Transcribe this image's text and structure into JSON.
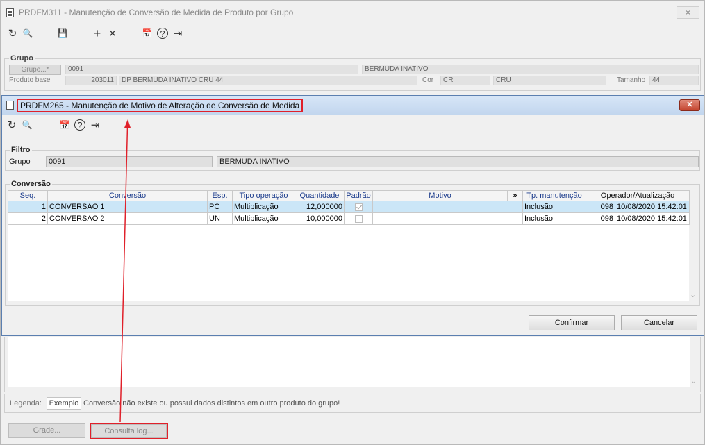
{
  "outer": {
    "title": "PRDFM311 - Manutenção de Conversão de Medida de Produto por Grupo",
    "close_icon": "×",
    "toolbar": {
      "refresh_icon": "↻",
      "search_icon": "🔍",
      "save_icon": "💾",
      "add_icon": "+",
      "delete_icon": "×",
      "calendar_icon": "📅",
      "help_icon": "?",
      "exit_icon": "⇥"
    },
    "grupo_section": {
      "legend": "Grupo",
      "grupo_button": "Grupo...*",
      "grupo_code": "0091",
      "grupo_name": "BERMUDA INATIVO",
      "produto_base_label": "Produto base",
      "produto_base_code": "203011",
      "produto_base_name": "DP BERMUDA INATIVO CRU 44",
      "cor_label": "Cor",
      "cor_code": "CR",
      "cor_name": "CRU",
      "tamanho_label": "Tamanho",
      "tamanho_value": "44"
    },
    "legenda_label": "Legenda:",
    "legenda_example": "Exemplo",
    "legenda_text": "Conversão não existe ou possui dados distintos em outro produto do grupo!",
    "grade_button": "Grade...",
    "consulta_log_button": "Consulta log..."
  },
  "inner": {
    "title": "PRDFM265 - Manutenção de Motivo de Alteração de Conversão de Medida",
    "close_icon": "✕",
    "toolbar": {
      "refresh_icon": "↻",
      "search_icon": "🔍",
      "calendar_icon": "📅",
      "help_icon": "?",
      "exit_icon": "⇥"
    },
    "filtro": {
      "legend": "Filtro",
      "grupo_label": "Grupo",
      "grupo_code": "0091",
      "grupo_name": "BERMUDA INATIVO"
    },
    "conversao": {
      "legend": "Conversão",
      "columns": [
        "Seq.",
        "Conversão",
        "Esp.",
        "Tipo operação",
        "Quantidade",
        "Padrão",
        "Motivo",
        "»",
        "Tp. manutenção",
        "Operador/Atualização"
      ],
      "rows": [
        {
          "seq": "1",
          "conversao": "CONVERSAO 1",
          "esp": "PC",
          "tipo": "Multiplicação",
          "quantidade": "12,000000",
          "padrao": true,
          "motivo_a": "",
          "motivo_b": "",
          "tp": "Inclusão",
          "operador": "098",
          "atualizacao": "10/08/2020 15:42:01"
        },
        {
          "seq": "2",
          "conversao": "CONVERSAO 2",
          "esp": "UN",
          "tipo": "Multiplicação",
          "quantidade": "10,000000",
          "padrao": false,
          "motivo_a": "",
          "motivo_b": "",
          "tp": "Inclusão",
          "operador": "098",
          "atualizacao": "10/08/2020 15:42:01"
        }
      ]
    },
    "confirmar_button": "Confirmar",
    "cancelar_button": "Cancelar"
  },
  "colors": {
    "highlight_red": "#e0202a",
    "selected_row": "#cbe6f7",
    "header_text": "#1c3c8c"
  }
}
